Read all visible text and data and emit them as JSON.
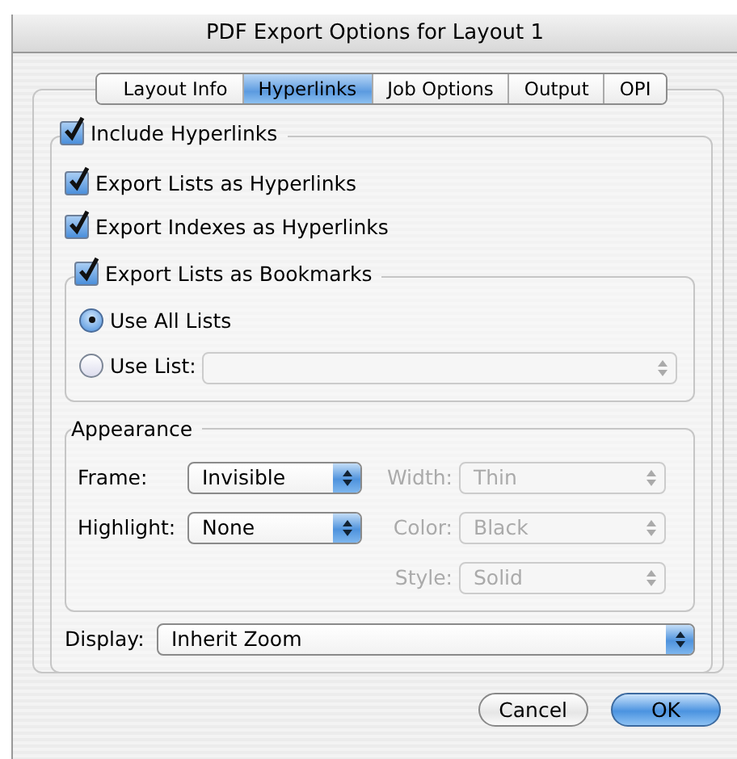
{
  "window": {
    "title": "PDF Export Options for Layout 1"
  },
  "tabs": [
    {
      "label": "Layout Info",
      "selected": false
    },
    {
      "label": "Hyperlinks",
      "selected": true
    },
    {
      "label": "Job Options",
      "selected": false
    },
    {
      "label": "Output",
      "selected": false
    },
    {
      "label": "OPI",
      "selected": false
    }
  ],
  "include_hyperlinks": {
    "label": "Include Hyperlinks",
    "checked": true
  },
  "options": [
    {
      "label": "Export Lists as Hyperlinks",
      "checked": true
    },
    {
      "label": "Export Indexes as Hyperlinks",
      "checked": true
    }
  ],
  "bookmarks": {
    "label": "Export Lists as Bookmarks",
    "checked": true,
    "choices": [
      {
        "label": "Use All Lists",
        "selected": true
      },
      {
        "label": "Use List:",
        "selected": false
      }
    ],
    "list_popup": {
      "disabled": true
    }
  },
  "appearance": {
    "title": "Appearance",
    "left": [
      {
        "label": "Frame:",
        "value": "Invisible",
        "disabled": false
      },
      {
        "label": "Highlight:",
        "value": "None",
        "disabled": false
      }
    ],
    "right": [
      {
        "label": "Width:",
        "value": "Thin",
        "disabled": true
      },
      {
        "label": "Color:",
        "value": "Black",
        "disabled": true
      },
      {
        "label": "Style:",
        "value": "Solid",
        "disabled": true
      }
    ]
  },
  "display": {
    "label": "Display:",
    "value": "Inherit Zoom",
    "disabled": false
  },
  "buttons": [
    {
      "label": "Cancel",
      "kind": "secondary"
    },
    {
      "label": "OK",
      "kind": "default"
    }
  ]
}
